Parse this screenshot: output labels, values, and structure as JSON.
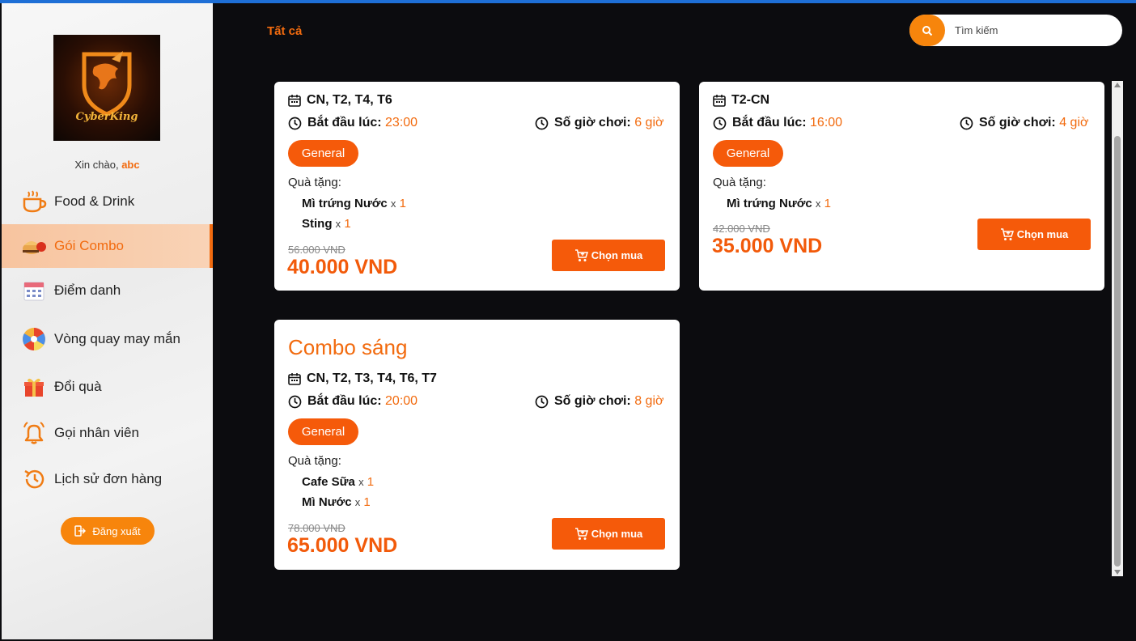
{
  "app": {
    "logo_text": "CyberKing",
    "greeting_prefix": "Xin chào,",
    "username": "abc"
  },
  "sidebar": {
    "items": [
      {
        "label": "Food & Drink",
        "icon": "coffee-cup-icon"
      },
      {
        "label": "Gói Combo",
        "icon": "combo-food-icon",
        "active": true
      },
      {
        "label": "Điểm danh",
        "icon": "calendar-icon"
      },
      {
        "label": "Vòng quay may mắn",
        "icon": "lucky-wheel-icon"
      },
      {
        "label": "Đổi quà",
        "icon": "gift-icon"
      },
      {
        "label": "Gọi nhân viên",
        "icon": "bell-icon"
      },
      {
        "label": "Lịch sử đơn hàng",
        "icon": "history-icon"
      }
    ],
    "logout_label": "Đăng xuất"
  },
  "header": {
    "filter_label": "Tất cả",
    "search_placeholder": "Tìm kiếm"
  },
  "labels": {
    "start_prefix": "Bắt đầu lúc:",
    "hours_prefix": "Số giờ chơi:",
    "gifts_label": "Quà tặng:",
    "buy_label": "Chọn mua",
    "gift_x": "x"
  },
  "combos": [
    {
      "title": "",
      "days": "CN, T2, T4, T6",
      "start_time": "23:00",
      "hours": "6 giờ",
      "badge": "General",
      "gifts": [
        {
          "name": "Mì trứng Nước",
          "qty": "1"
        },
        {
          "name": "Sting",
          "qty": "1"
        }
      ],
      "old_price": "56.000 VND",
      "price": "40.000 VND"
    },
    {
      "title": "",
      "days": "T2-CN",
      "start_time": "16:00",
      "hours": "4 giờ",
      "badge": "General",
      "gifts": [
        {
          "name": "Mì trứng Nước",
          "qty": "1"
        }
      ],
      "old_price": "42.000 VND",
      "price": "35.000 VND"
    },
    {
      "title": "Combo sáng",
      "days": "CN, T2, T3, T4, T6, T7",
      "start_time": "20:00",
      "hours": "8 giờ",
      "badge": "General",
      "gifts": [
        {
          "name": "Cafe Sữa",
          "qty": "1"
        },
        {
          "name": "Mì Nước",
          "qty": "1"
        }
      ],
      "old_price": "78.000 VND",
      "price": "65.000 VND"
    }
  ],
  "colors": {
    "accent": "#f26b0f",
    "button": "#f55a0a",
    "background": "#0c0c0f",
    "active_nav": "#f9cba8"
  }
}
